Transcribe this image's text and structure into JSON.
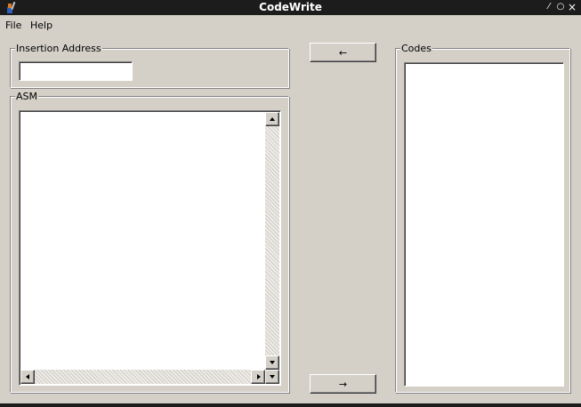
{
  "window": {
    "title": "CodeWrite",
    "controls": {
      "minimize": "⁄",
      "maximize": "○",
      "close": "×"
    }
  },
  "menu": {
    "items": [
      {
        "label": "File"
      },
      {
        "label": "Help"
      }
    ]
  },
  "insertion_address": {
    "legend": "Insertion Address",
    "value": "",
    "placeholder": ""
  },
  "asm": {
    "legend": "ASM",
    "content": ""
  },
  "codes": {
    "legend": "Codes",
    "content": ""
  },
  "buttons": {
    "left_arrow": "←",
    "right_arrow": "→"
  },
  "colors": {
    "window_bg": "#d4d0c8",
    "titlebar_bg": "#1c1c1c",
    "field_bg": "#ffffff"
  },
  "icons": [
    "app-icon",
    "minimize-icon",
    "maximize-icon",
    "close-icon",
    "scroll-up-icon",
    "scroll-down-icon",
    "scroll-left-icon",
    "scroll-right-icon"
  ]
}
